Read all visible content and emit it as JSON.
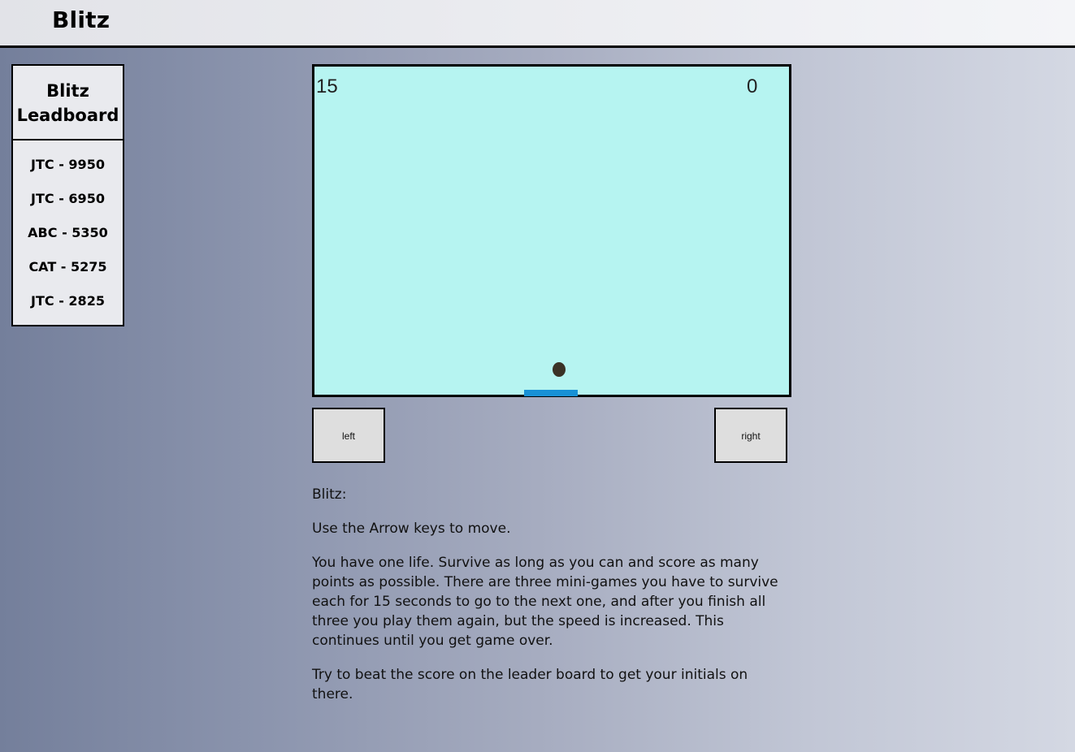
{
  "header": {
    "title": "Blitz"
  },
  "leaderboard": {
    "title_line1": "Blitz",
    "title_line2": "Leadboard",
    "entries": [
      "JTC - 9950",
      "JTC - 6950",
      "ABC - 5350",
      "CAT - 5275",
      "JTC - 2825"
    ]
  },
  "game": {
    "timer": "15",
    "score": "0",
    "colors": {
      "background": "#b6f4f1",
      "ball": "#3a3226",
      "paddle": "#1891d6"
    }
  },
  "controls": {
    "left_label": "left",
    "right_label": "right"
  },
  "instructions": {
    "heading": "Blitz:",
    "line1": "Use the Arrow keys to move.",
    "line2": "You have one life. Survive as long as you can and score as many points as possible. There are three mini-games you have to survive each for 15 seconds to go to the next one, and after you finish all three you play them again, but the speed is increased. This continues until you get game over.",
    "line3": "Try to beat the score on the leader board to get your initials on there."
  }
}
